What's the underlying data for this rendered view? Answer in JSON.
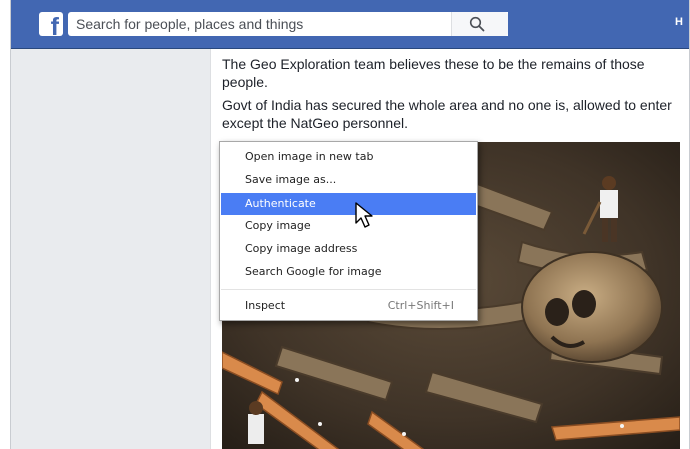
{
  "header": {
    "logo_letter": "f",
    "search_placeholder": "Search for people, places and things",
    "right_cut": "H"
  },
  "post": {
    "text1": "The Geo Exploration team believes these to be the remains of those people.",
    "text2": "Govt of India has secured the whole area and no one is, allowed to enter except the NatGeo personnel."
  },
  "context_menu": {
    "items": [
      {
        "label": "Open image in new tab",
        "shortcut": ""
      },
      {
        "label": "Save image as...",
        "shortcut": ""
      },
      {
        "label": "Authenticate",
        "shortcut": "",
        "highlighted": true
      },
      {
        "label": "Copy image",
        "shortcut": ""
      },
      {
        "label": "Copy image address",
        "shortcut": ""
      },
      {
        "label": "Search Google for image",
        "shortcut": ""
      },
      {
        "label": "Inspect",
        "shortcut": "Ctrl+Shift+I"
      }
    ]
  },
  "colors": {
    "facebook_blue": "#4267b2",
    "menu_highlight": "#4a7df4",
    "page_background": "#e9ebee"
  },
  "icons": {
    "logo": "facebook-logo",
    "search": "search-icon",
    "cursor": "mouse-pointer-icon"
  }
}
